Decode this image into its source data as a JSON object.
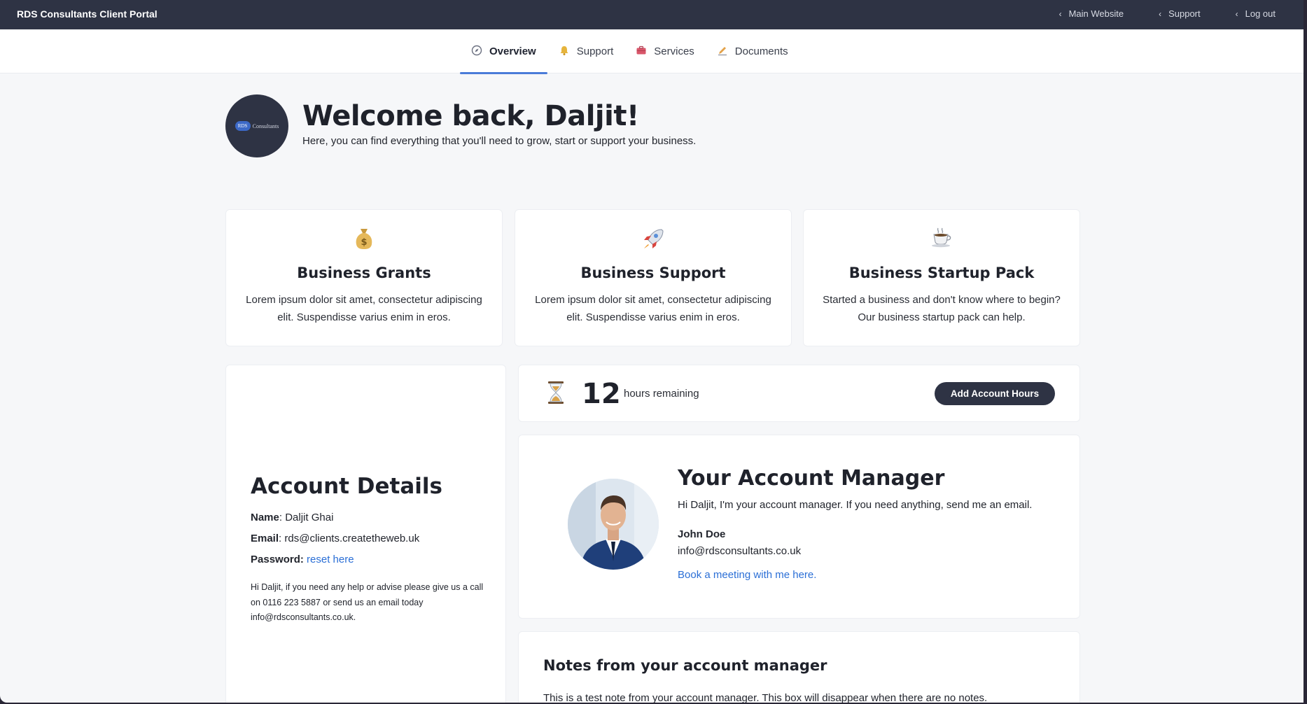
{
  "topbar": {
    "brand": "RDS Consultants Client Portal",
    "links": [
      {
        "label": "Main Website",
        "icon": "chevron-left-icon"
      },
      {
        "label": "Support",
        "icon": "chevron-left-icon"
      },
      {
        "label": "Log out",
        "icon": "chevron-left-icon"
      }
    ]
  },
  "tabs": [
    {
      "label": "Overview",
      "icon": "compass-icon",
      "active": true
    },
    {
      "label": "Support",
      "icon": "bell-icon",
      "active": false
    },
    {
      "label": "Services",
      "icon": "briefcase-icon",
      "active": false
    },
    {
      "label": "Documents",
      "icon": "pen-icon",
      "active": false
    }
  ],
  "welcome": {
    "logo_badge": "RDS",
    "logo_text": "Consultants",
    "title": "Welcome back, Daljit!",
    "subtitle": "Here, you can find everything that you'll need to grow, start or support your business."
  },
  "services": [
    {
      "icon": "money-bag-icon",
      "title": "Business Grants",
      "description": "Lorem ipsum dolor sit amet, consectetur adipiscing elit. Suspendisse varius enim in eros."
    },
    {
      "icon": "rocket-icon",
      "title": "Business Support",
      "description": "Lorem ipsum dolor sit amet, consectetur adipiscing elit. Suspendisse varius enim in eros."
    },
    {
      "icon": "coffee-icon",
      "title": "Business Startup Pack",
      "description": "Started a business and don't know where to begin? Our business startup pack can help."
    }
  ],
  "account": {
    "title": "Account Details",
    "name_label": "Name",
    "name_value": "Daljit Ghai",
    "email_label": "Email",
    "email_value": "rds@clients.createtheweb.uk",
    "password_label": "Password:",
    "password_link": "reset here",
    "note": "Hi Daljit, if you need any help or advise please give us a call on 0116 223 5887 or send us an email today info@rdsconsultants.co.uk."
  },
  "hours": {
    "icon": "hourglass-icon",
    "value": "12",
    "label": "hours remaining",
    "button": "Add Account Hours"
  },
  "manager": {
    "title": "Your Account Manager",
    "intro": "Hi Daljit, I'm your account manager. If you need anything, send me an email.",
    "name": "John Doe",
    "email": "info@rdsconsultants.co.uk",
    "meeting_link": "Book a meeting with me here."
  },
  "notes": {
    "title": "Notes from your account manager",
    "text": "This is a test note from your account manager. This box will disappear when there are no notes."
  },
  "colors": {
    "topbar": "#2e3344",
    "accent": "#4a7bd8",
    "link": "#2b6fd6",
    "background": "#f6f7f9"
  }
}
